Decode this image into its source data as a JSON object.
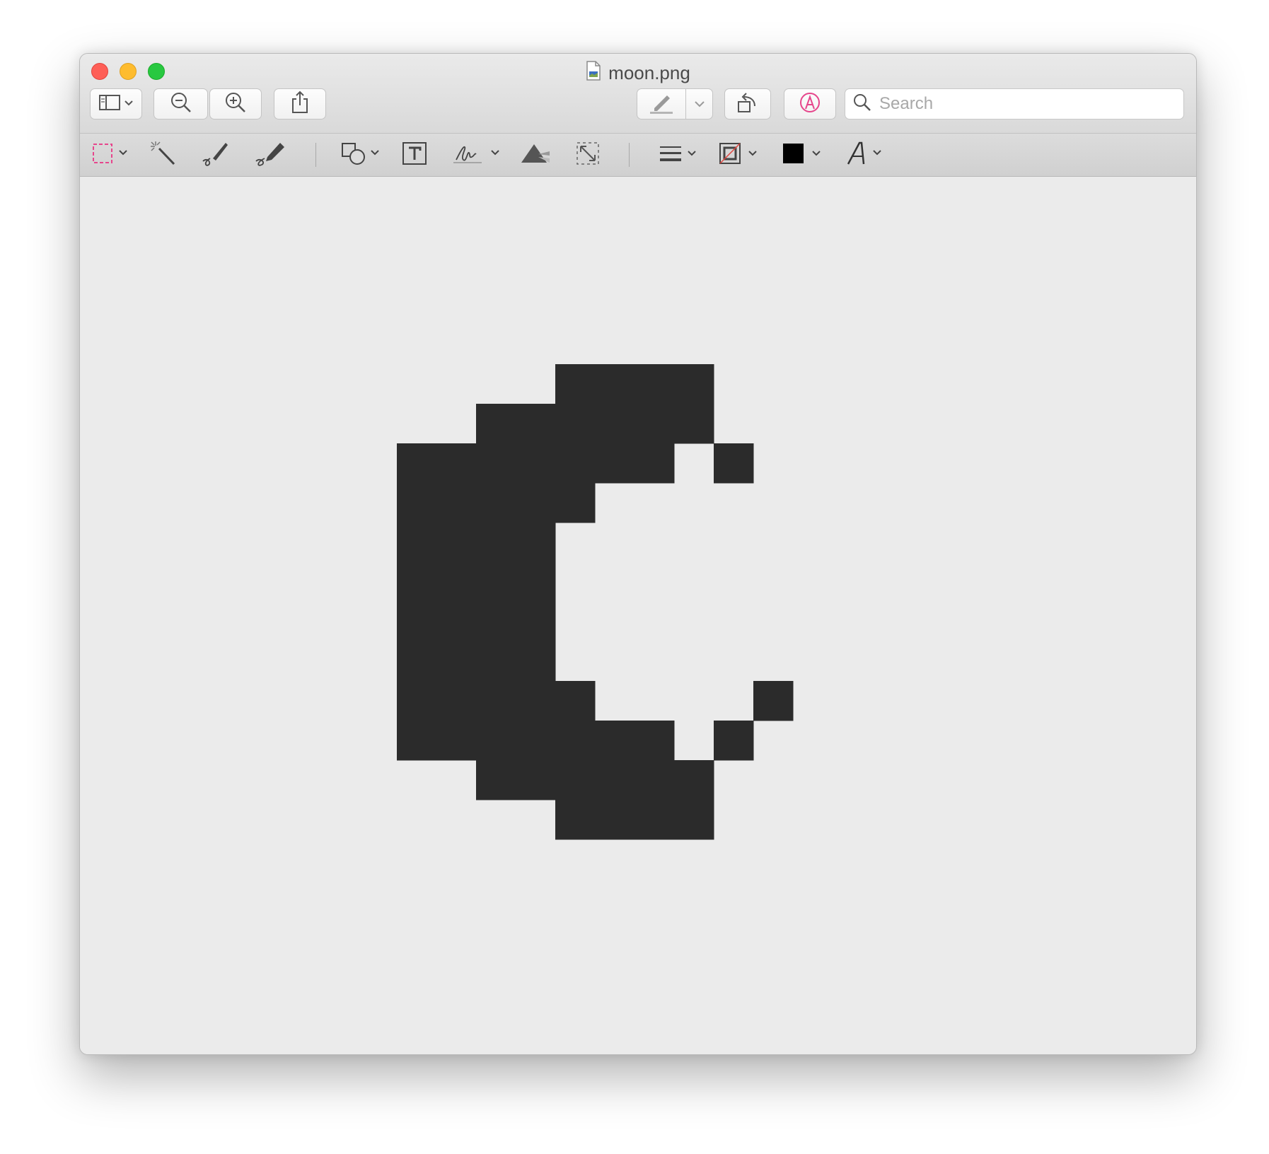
{
  "window": {
    "title": "moon.png"
  },
  "toolbar": {
    "search_placeholder": "Search",
    "icons": [
      "sidebar-icon",
      "zoom-out-icon",
      "zoom-in-icon",
      "share-icon",
      "highlight-icon",
      "rotate-icon",
      "markup-icon",
      "search-icon"
    ]
  },
  "markup_toolbar": {
    "tools": [
      "selection-tool",
      "instant-alpha",
      "sketch",
      "draw",
      "shapes",
      "text",
      "sign",
      "adjust-color",
      "adjust-size",
      "line-style",
      "border-color",
      "fill-color",
      "text-style"
    ],
    "accent_color": "#e6468c",
    "fill_color": "#000000"
  },
  "image": {
    "pixel_color": "#2b2b2b",
    "background": "#ebebeb",
    "grid": [
      "....####...",
      "..######...",
      "#######.#..",
      "#####......",
      "####.......",
      "####.......",
      "####.......",
      "####.......",
      "#####....#.",
      "#######.#..",
      "..######...",
      "....####..."
    ]
  }
}
